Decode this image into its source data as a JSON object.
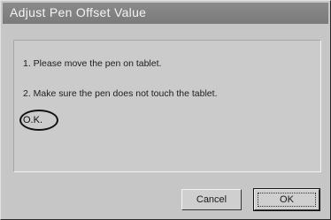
{
  "window": {
    "title": "Adjust Pen Offset Value"
  },
  "instructions": [
    "1. Please move the pen on tablet.",
    "2. Make sure the pen does not touch the tablet."
  ],
  "status": "O.K.",
  "buttons": {
    "cancel": "Cancel",
    "ok": "OK"
  }
}
